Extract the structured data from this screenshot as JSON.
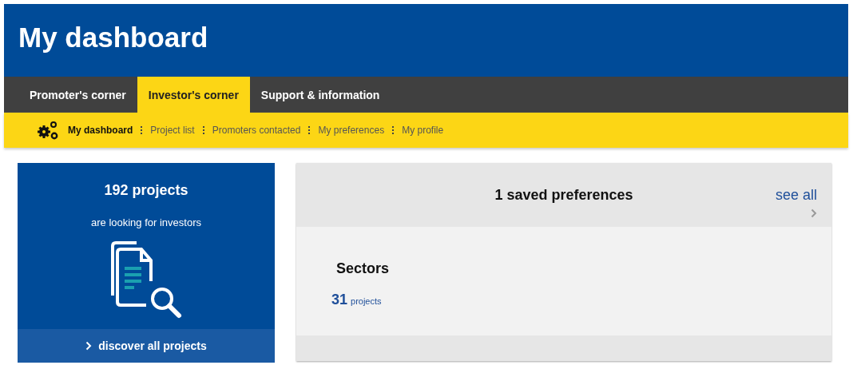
{
  "header": {
    "title": "My dashboard"
  },
  "tabs": [
    {
      "label": "Promoter's corner",
      "selected": false
    },
    {
      "label": "Investor's corner",
      "selected": true
    },
    {
      "label": "Support & information",
      "selected": false
    }
  ],
  "subnav": [
    {
      "label": "My dashboard",
      "selected": true
    },
    {
      "label": "Project list",
      "selected": false
    },
    {
      "label": "Promoters contacted",
      "selected": false
    },
    {
      "label": "My preferences",
      "selected": false
    },
    {
      "label": "My profile",
      "selected": false
    }
  ],
  "projects_card": {
    "count": "192 projects",
    "subtitle": "are looking for investors",
    "link": "discover all projects"
  },
  "preferences_card": {
    "title": "1 saved preferences",
    "see_all": "see all",
    "items": [
      {
        "name": "Sectors",
        "count": "31",
        "unit": "projects"
      }
    ]
  }
}
